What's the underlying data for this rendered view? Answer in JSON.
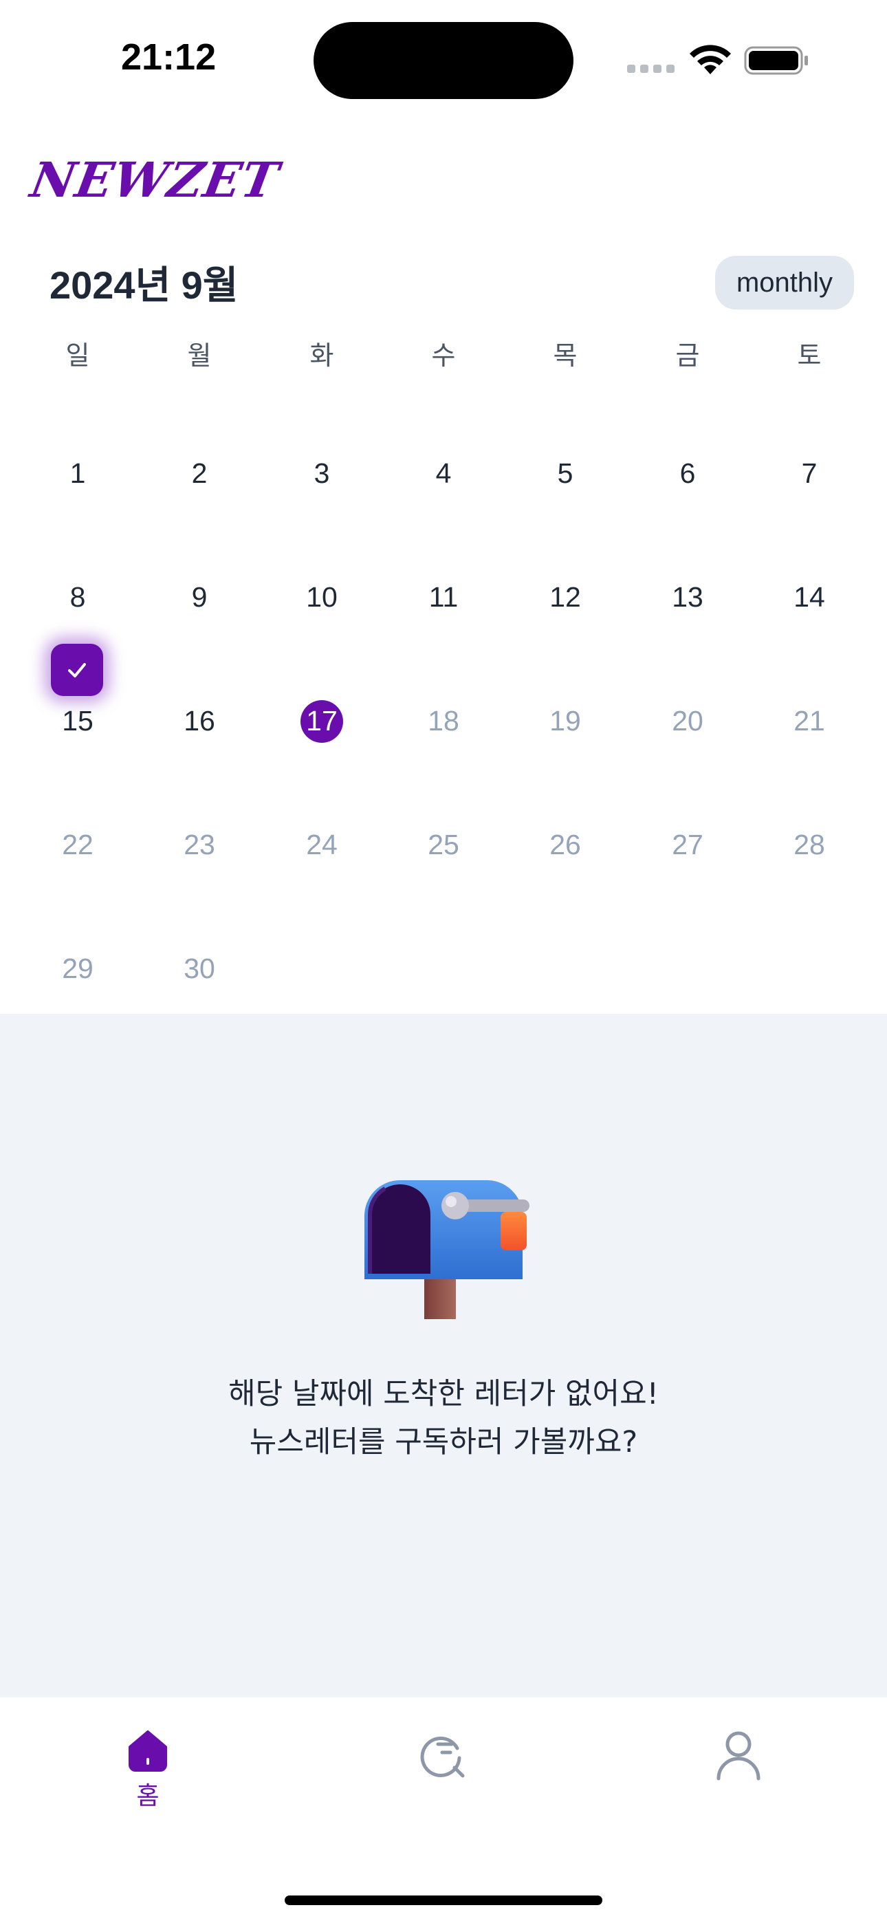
{
  "status_bar": {
    "time": "21:12"
  },
  "app": {
    "logo": "NEWZET"
  },
  "calendar": {
    "title": "2024년 9월",
    "view_toggle": "monthly",
    "weekdays": [
      "일",
      "월",
      "화",
      "수",
      "목",
      "금",
      "토"
    ],
    "today": "17",
    "checked_day": "15",
    "weeks": [
      [
        "1",
        "2",
        "3",
        "4",
        "5",
        "6",
        "7"
      ],
      [
        "8",
        "9",
        "10",
        "11",
        "12",
        "13",
        "14"
      ],
      [
        "15",
        "16",
        "17",
        "18",
        "19",
        "20",
        "21"
      ],
      [
        "22",
        "23",
        "24",
        "25",
        "26",
        "27",
        "28"
      ],
      [
        "29",
        "30"
      ]
    ]
  },
  "empty_state": {
    "line1": "해당 날짜에 도착한 레터가 없어요!",
    "line2": "뉴스레터를 구독하러 가볼까요?"
  },
  "tabs": [
    {
      "label": "홈",
      "icon": "home-icon",
      "active": true
    },
    {
      "label": "",
      "icon": "search-icon",
      "active": false
    },
    {
      "label": "",
      "icon": "profile-icon",
      "active": false
    }
  ],
  "colors": {
    "brand": "#6a0dad",
    "future_day": "#94a3b8",
    "panel_bg": "#f0f3f8"
  }
}
